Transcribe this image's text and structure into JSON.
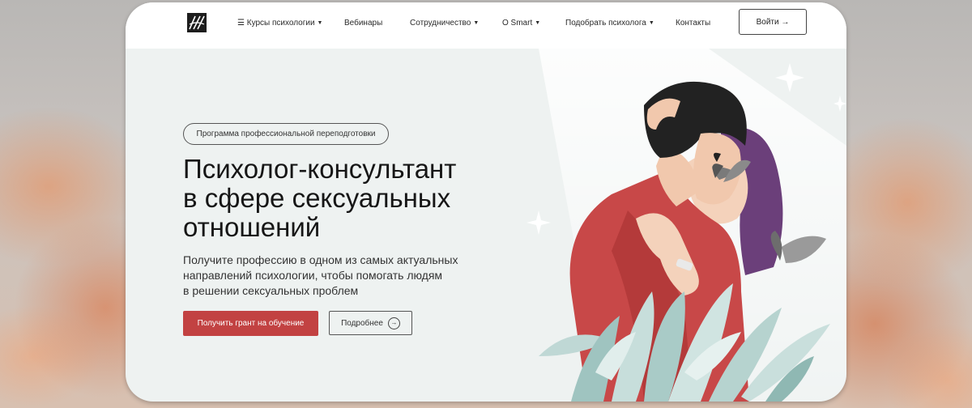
{
  "nav": {
    "logo": "logo-icon",
    "courses": "☰ Курсы психологии",
    "webinars": "Вебинары",
    "cooperation": "Сотрудничество",
    "about": "О Smart",
    "find_psychologist": "Подобрать психолога",
    "contacts": "Контакты",
    "login": "Войти →"
  },
  "hero": {
    "tag": "Программа профессиональной переподготовки",
    "title_lines": [
      "Психолог-консультант",
      "в сфере сексуальных",
      "отношений"
    ],
    "subtitle_lines": [
      "Получите профессию в одном из самых актуальных",
      "направлений психологии, чтобы помогать людям",
      "в решении сексуальных проблем"
    ],
    "primary_button": "Получить грант на обучение",
    "secondary_button": "Подробнее"
  },
  "colors": {
    "accent": "#c24242",
    "hero_background": "#eef2f1"
  }
}
